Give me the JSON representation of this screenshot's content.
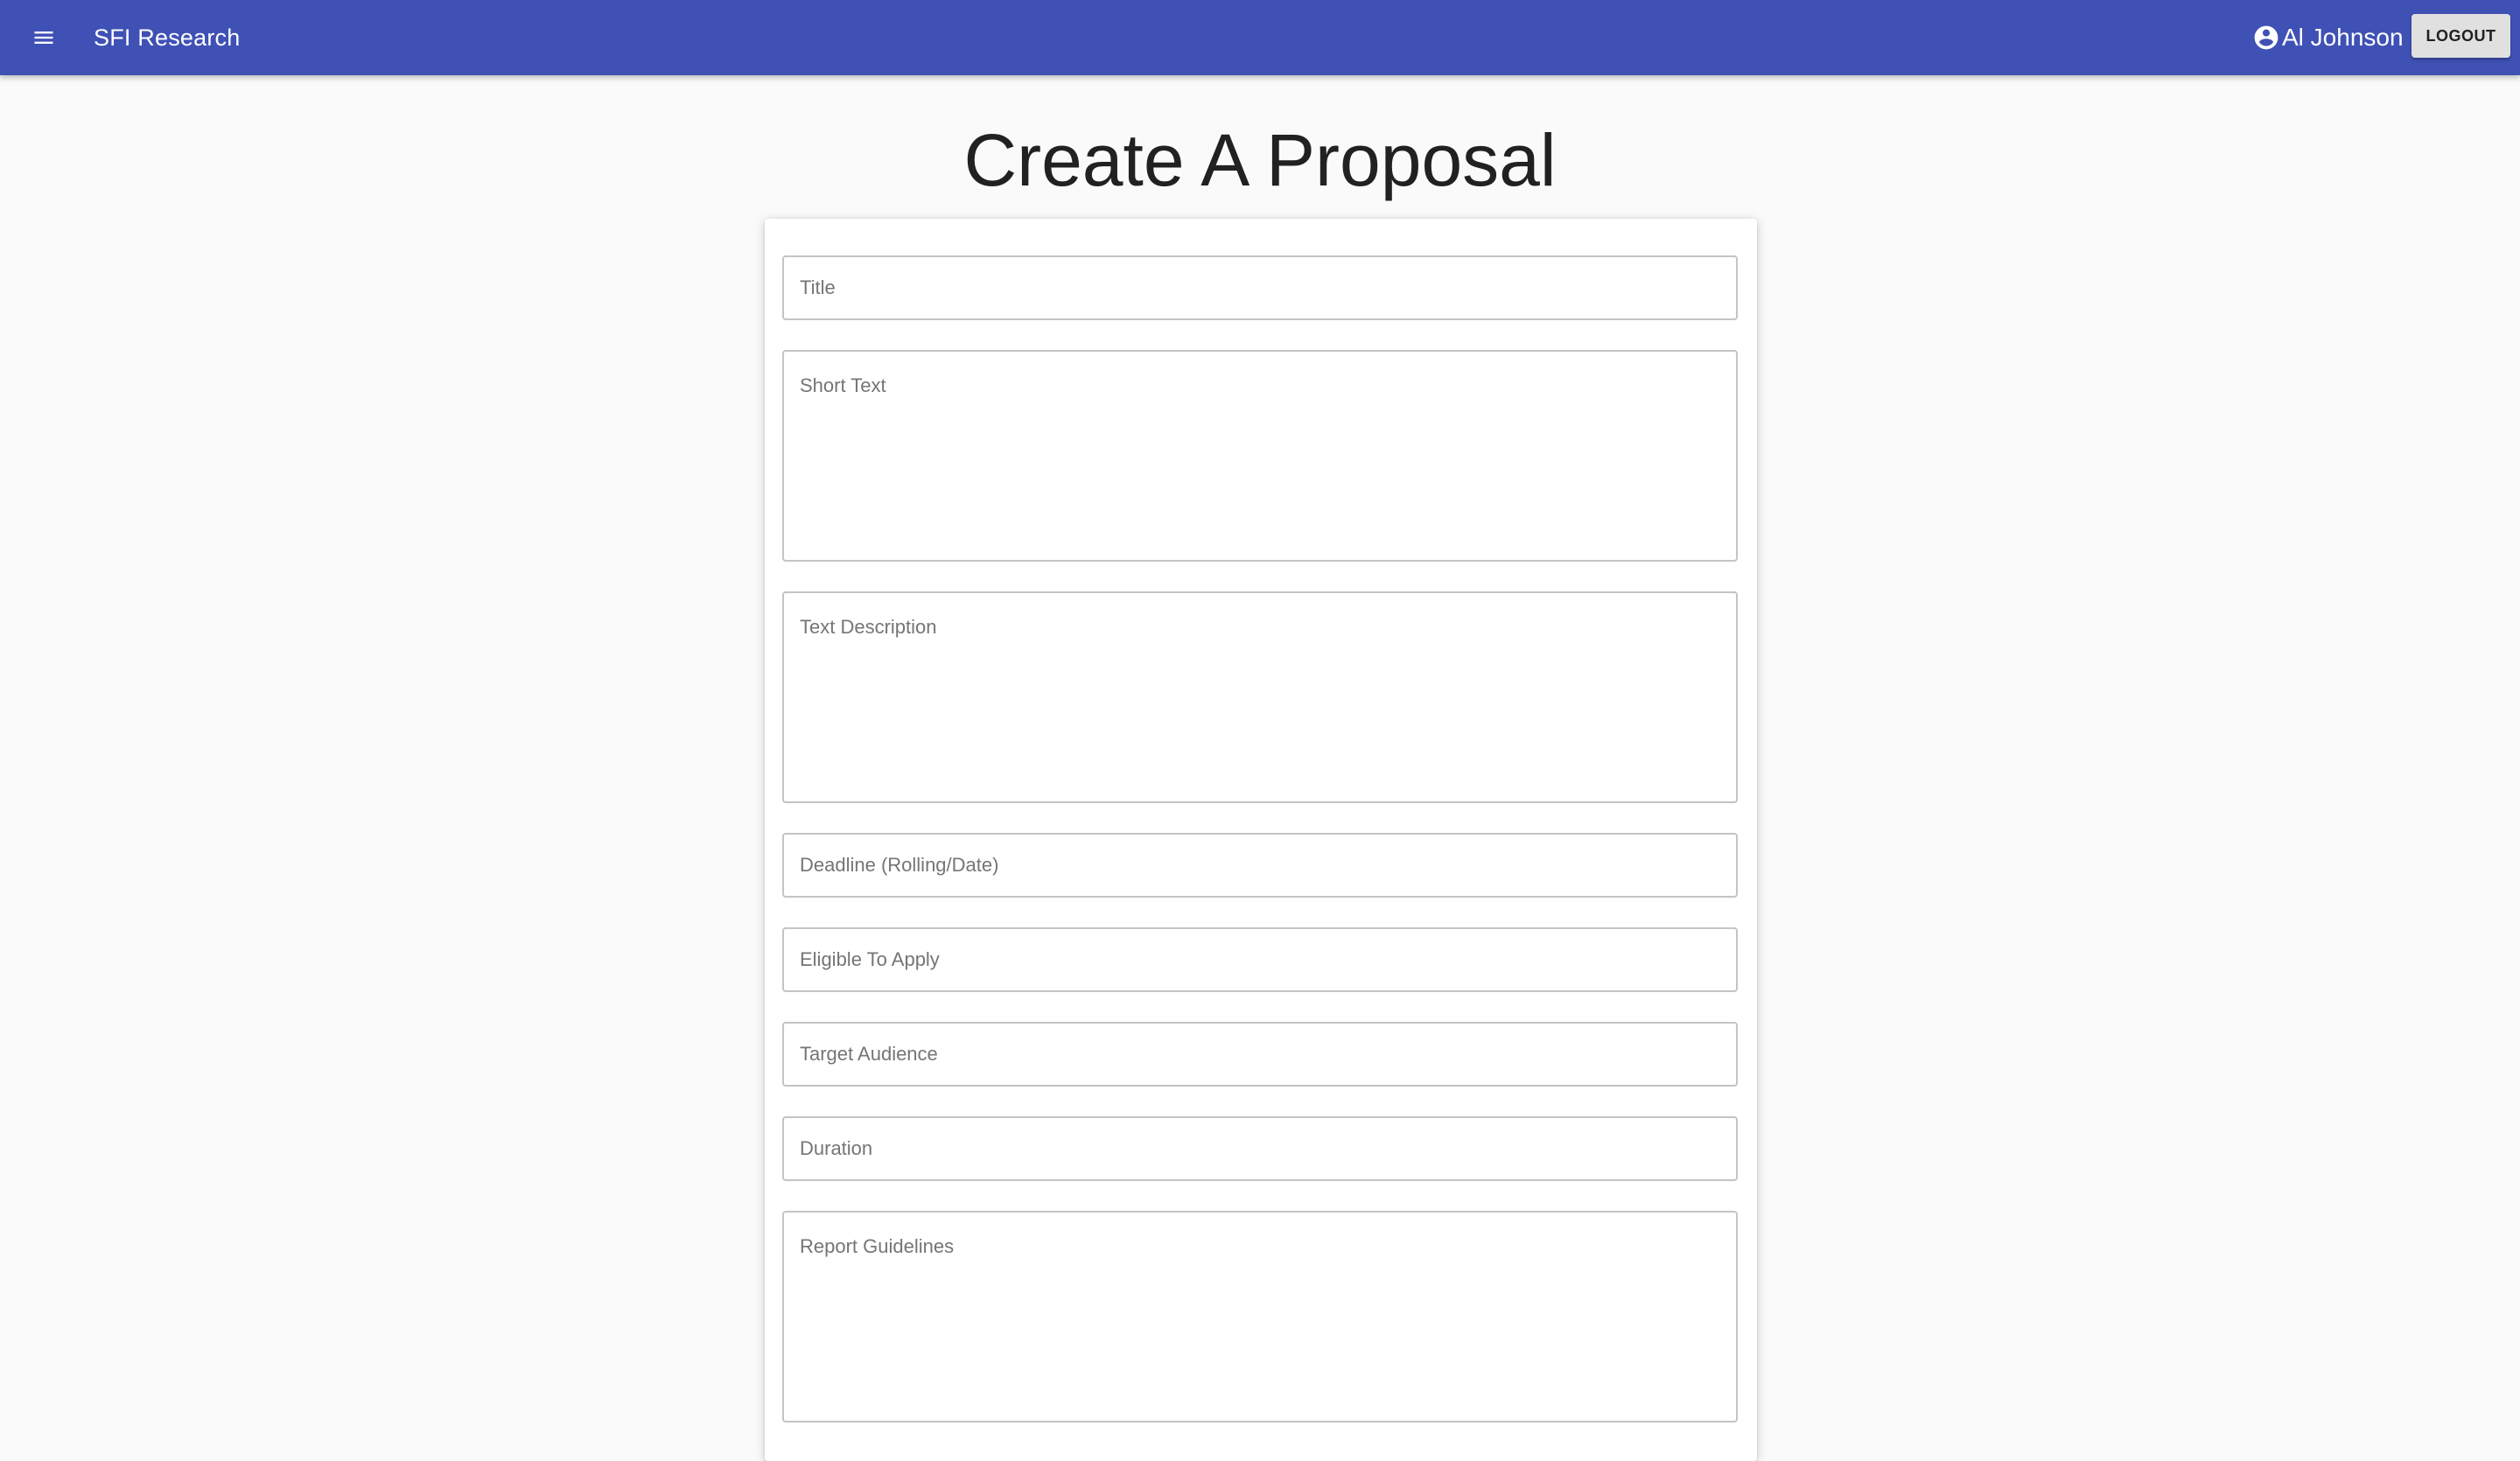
{
  "appbar": {
    "title": "SFI Research",
    "user_name": "Al Johnson",
    "logout_label": "LOGOUT",
    "color": "#3f51b5",
    "icons": {
      "menu": "menu-icon",
      "user": "account-circle-icon"
    }
  },
  "page": {
    "title": "Create A Proposal"
  },
  "form": {
    "title": {
      "value": "",
      "placeholder": "Title"
    },
    "short_text": {
      "value": "",
      "placeholder": "Short Text"
    },
    "text_description": {
      "value": "",
      "placeholder": "Text Description"
    },
    "deadline": {
      "value": "",
      "placeholder": "Deadline (Rolling/Date)"
    },
    "eligible_to_apply": {
      "value": "",
      "placeholder": "Eligible To Apply"
    },
    "target_audience": {
      "value": "",
      "placeholder": "Target Audience"
    },
    "duration": {
      "value": "",
      "placeholder": "Duration"
    },
    "report_guidelines": {
      "value": "",
      "placeholder": "Report Guidelines"
    }
  }
}
